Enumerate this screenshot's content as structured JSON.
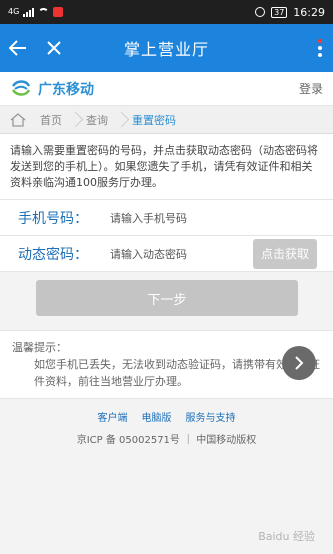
{
  "status_bar": {
    "carrier": "4G",
    "battery": "37",
    "time": "16:29"
  },
  "header": {
    "title": "掌上营业厅",
    "back_icon": "back-arrow-icon",
    "close_icon": "close-icon",
    "more_icon": "more-vertical-icon"
  },
  "brand": {
    "name": "广东移动",
    "login": "登录",
    "color": "#2b8fd4"
  },
  "breadcrumb": {
    "items": [
      "首页",
      "查询",
      "重置密码"
    ]
  },
  "notice": {
    "text": "请输入需要重置密码的号码，并点击获取动态密码（动态密码将发送到您的手机上）。如果您遗失了手机，请凭有效证件和相关资料亲临沟通100服务厅办理。"
  },
  "form": {
    "phone": {
      "label": "手机号码：",
      "placeholder": "请输入手机号码"
    },
    "dynamic": {
      "label": "动态密码：",
      "placeholder": "请输入动态密码",
      "button": "点击获取"
    }
  },
  "next_button": "下一步",
  "tips": {
    "title": "温馨提示：",
    "body": "如您手机已丢失，无法收到动态验证码，请携带有效身份证件资料，前往当地营业厅办理。"
  },
  "footer": {
    "links": [
      "客户端",
      "电脑版",
      "服务与支持"
    ],
    "copyright": "京ICP 备 05002571号 ｜ 中国移动版权"
  },
  "watermark": "Baidu 经验",
  "colors": {
    "title_bar": "#1d84dd",
    "accent": "#1d6fb8"
  }
}
